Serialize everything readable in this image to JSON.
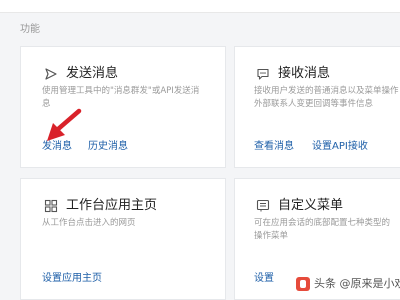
{
  "section": {
    "label": "功能"
  },
  "cards": {
    "send": {
      "title": "发送消息",
      "icon": "send-arrow-icon",
      "desc_line1": "使用管理工具中的\"消息群发\"或API发送消",
      "desc_line2": "息",
      "links": [
        "发消息",
        "历史消息"
      ]
    },
    "receive": {
      "title": "接收消息",
      "icon": "chat-bubble-icon",
      "desc_line1": "接收用户发送的普通消息以及菜单操作",
      "desc_line2": "外部联系人变更回调等事件信息",
      "links": [
        "查看消息",
        "设置API接收"
      ]
    },
    "workbench": {
      "title": "工作台应用主页",
      "icon": "grid-icon",
      "desc_line1": "从工作台点击进入的网页",
      "links": [
        "设置应用主页"
      ]
    },
    "menu": {
      "title": "自定义菜单",
      "icon": "menu-list-icon",
      "desc_line1": "可在应用会话的底部配置七种类型的",
      "desc_line2": "操作菜单",
      "links": [
        "设置"
      ]
    }
  },
  "watermark": {
    "text": "头条 @原来是小欢"
  },
  "colors": {
    "link": "#1e5fa8",
    "arrow": "#d9222a",
    "background": "#f4f5f7",
    "card": "#ffffff"
  }
}
